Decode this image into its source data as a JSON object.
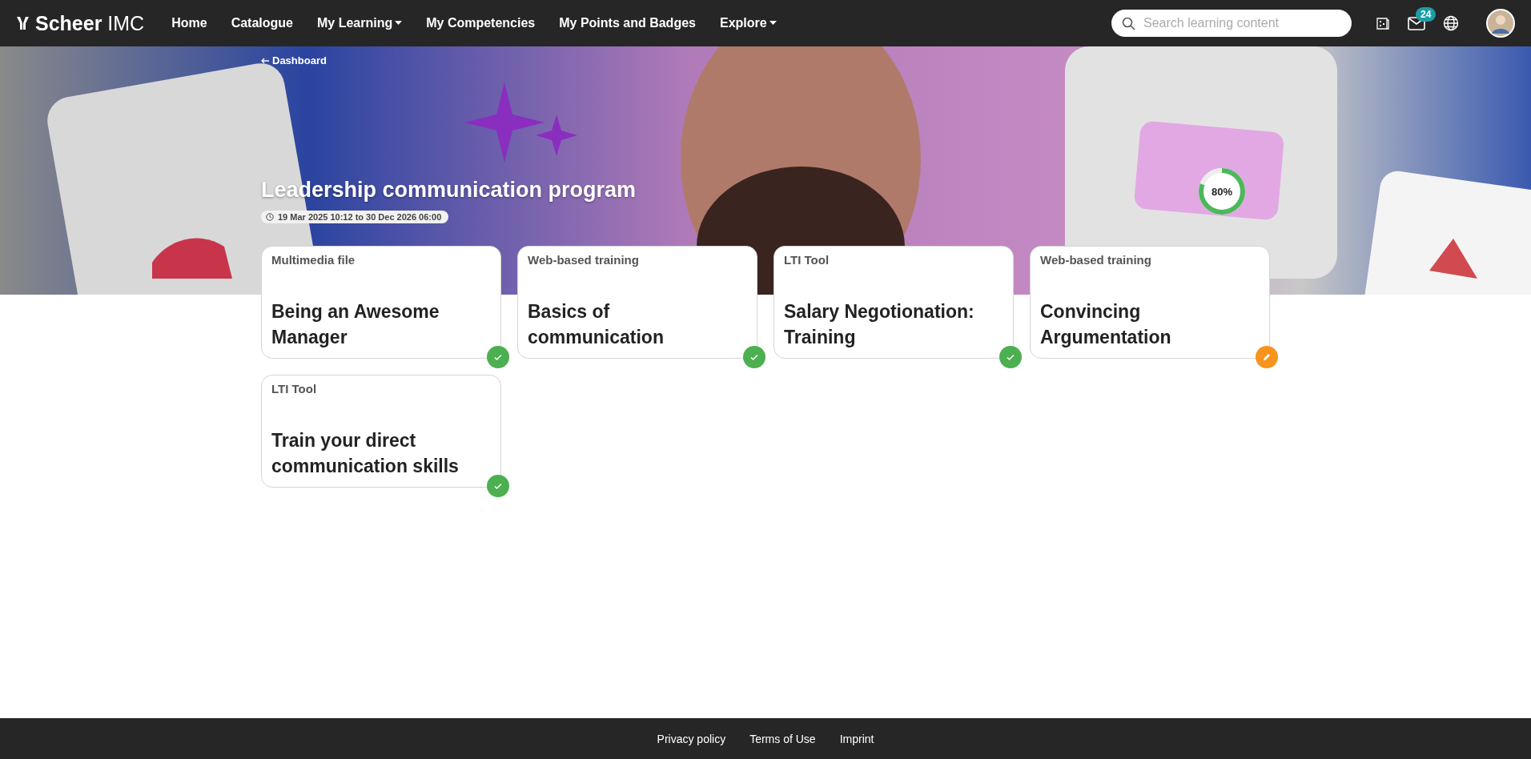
{
  "header": {
    "logo": "**Scheer** IMC",
    "nav": [
      {
        "label": "Home",
        "has_menu": false
      },
      {
        "label": "Catalogue",
        "has_menu": false
      },
      {
        "label": "My Learning",
        "has_menu": true
      },
      {
        "label": "My Competencies",
        "has_menu": false
      },
      {
        "label": "My Points and Badges",
        "has_menu": false
      },
      {
        "label": "Explore",
        "has_menu": true
      }
    ],
    "search": {
      "placeholder": "Search learning content"
    },
    "mail_badge": "24"
  },
  "hero": {
    "back_link": "Dashboard",
    "title": "Leadership communication program",
    "dates": "19 Mar 2025 10:12 to 30 Dec 2026 06:00",
    "progress": {
      "label": "80%",
      "level": 0.8
    }
  },
  "courses": [
    {
      "type": "Multimedia file",
      "title": "Being an Awesome Manager",
      "completed": true
    },
    {
      "type": "Web-based training",
      "title": "Basics of communication",
      "completed": true
    },
    {
      "type": "LTI Tool",
      "title": "Salary Negotionation: Training",
      "completed": true
    },
    {
      "type": "Web-based training",
      "title": "Convincing Argumentation",
      "completed": false
    },
    {
      "type": "LTI Tool",
      "title": "Train your direct communication skills",
      "completed": true
    }
  ],
  "footer": {
    "links": [
      "Privacy policy",
      "Terms of Use",
      "Imprint"
    ]
  }
}
